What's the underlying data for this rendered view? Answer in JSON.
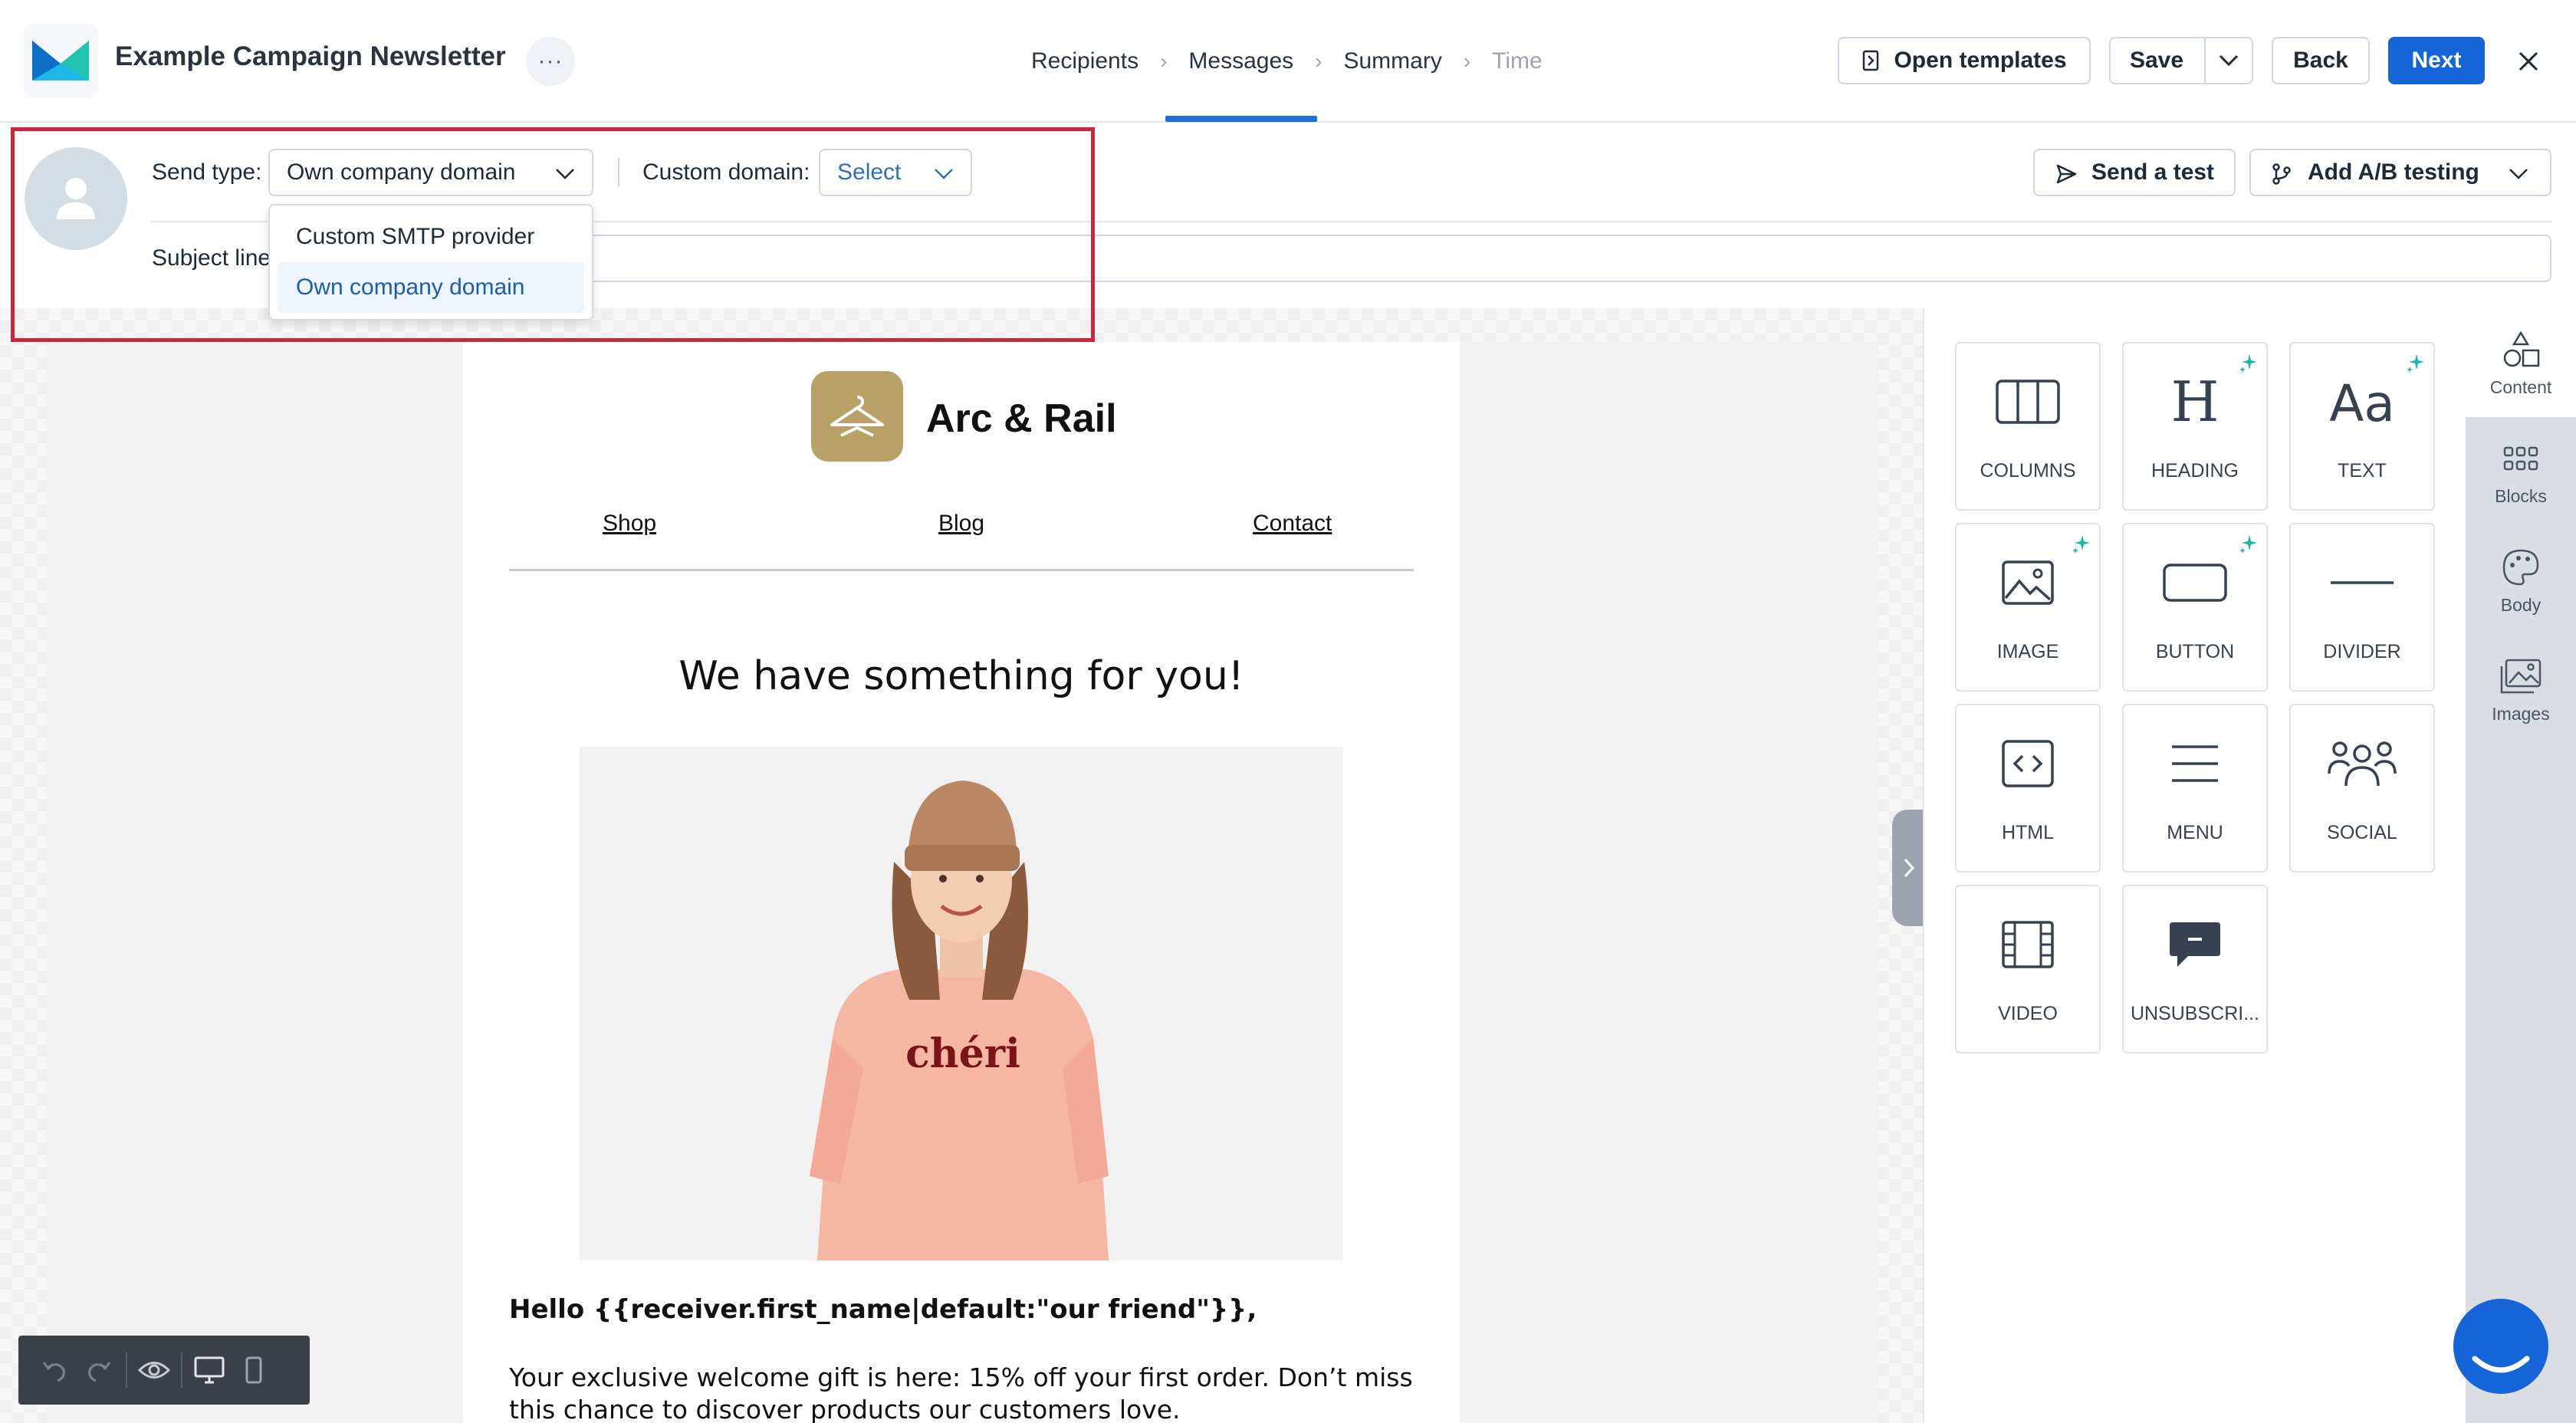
{
  "header": {
    "title": "Example Campaign Newsletter",
    "more_label": "···",
    "steps": [
      "Recipients",
      "Messages",
      "Summary",
      "Time"
    ],
    "open_templates_label": "Open templates",
    "save_label": "Save",
    "back_label": "Back",
    "next_label": "Next"
  },
  "sender": {
    "send_type_label": "Send type:",
    "send_type_value": "Own company domain",
    "custom_domain_label": "Custom domain:",
    "custom_domain_value": "Select",
    "subject_label": "Subject line",
    "send_test_label": "Send a test",
    "ab_testing_label": "Add A/B testing",
    "dropdown_options": [
      "Custom SMTP provider",
      "Own company domain"
    ]
  },
  "email": {
    "brand_name": "Arc & Rail",
    "nav": [
      "Shop",
      "Blog",
      "Contact"
    ],
    "headline": "We have something for you!",
    "hero_text": "chéri",
    "greeting": "Hello {{receiver.first_name|default:\"our friend\"}},",
    "body": "Your exclusive welcome gift is here: 15% off your first order. Don’t miss this chance to discover products our customers love."
  },
  "blocks": [
    {
      "label": "COLUMNS",
      "icon": "columns-icon"
    },
    {
      "label": "HEADING",
      "icon": "heading-icon",
      "ai": true
    },
    {
      "label": "TEXT",
      "icon": "text-icon",
      "ai": true
    },
    {
      "label": "IMAGE",
      "icon": "image-icon",
      "ai": true
    },
    {
      "label": "BUTTON",
      "icon": "button-icon",
      "ai": true
    },
    {
      "label": "DIVIDER",
      "icon": "divider-icon"
    },
    {
      "label": "HTML",
      "icon": "html-icon"
    },
    {
      "label": "MENU",
      "icon": "menu-icon"
    },
    {
      "label": "SOCIAL",
      "icon": "social-icon"
    },
    {
      "label": "VIDEO",
      "icon": "video-icon"
    },
    {
      "label": "UNSUBSCRI...",
      "icon": "unsubscribe-icon"
    }
  ],
  "sidebar": {
    "items": [
      "Content",
      "Blocks",
      "Body",
      "Images"
    ]
  },
  "colors": {
    "accent": "#1565d8",
    "highlight": "#c9283a",
    "brand_logo": "#b9a067",
    "ai_sparkle": "#14b8a6"
  }
}
